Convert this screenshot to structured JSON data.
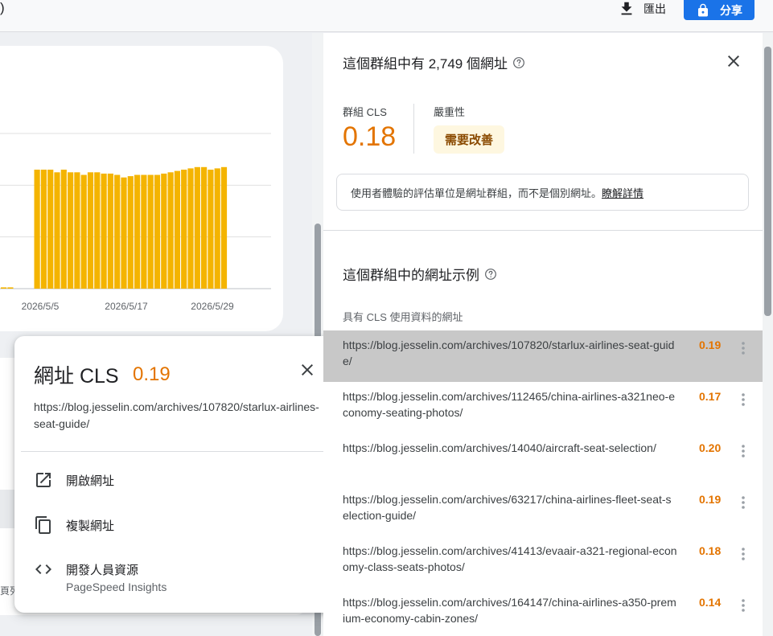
{
  "topbar": {
    "paren_fragment": ")",
    "export_label": "匯出",
    "share_label": "分享"
  },
  "chart_data": {
    "type": "bar",
    "x_tick_labels": [
      "2026/5/5",
      "2026/5/17",
      "2026/5/29"
    ],
    "values": [
      0.005,
      0.005,
      0,
      0,
      0,
      0.46,
      0.46,
      0.46,
      0.45,
      0.46,
      0.45,
      0.45,
      0.44,
      0.45,
      0.45,
      0.445,
      0.445,
      0.44,
      0.43,
      0.435,
      0.44,
      0.44,
      0.44,
      0.44,
      0.445,
      0.45,
      0.455,
      0.46,
      0.465,
      0.47,
      0.47,
      0.46,
      0.465,
      0.47
    ],
    "ylim": [
      0,
      0.6
    ],
    "color": "#f4b400",
    "grid": true,
    "legend": "none"
  },
  "left": {
    "truncated_text": "頁列"
  },
  "popup": {
    "title": "網址 CLS",
    "value": "0.19",
    "url": "https://blog.jesselin.com/archives/107820/starlux-airlines-seat-guide/",
    "items": [
      {
        "icon": "open-in-new-icon",
        "label": "開啟網址",
        "sub": ""
      },
      {
        "icon": "copy-icon",
        "label": "複製網址",
        "sub": ""
      },
      {
        "icon": "code-icon",
        "label": "開發人員資源",
        "sub": "PageSpeed Insights"
      }
    ]
  },
  "panel": {
    "title": "這個群組中有 2,749 個網址",
    "cls_label": "群組 CLS",
    "cls_value": "0.18",
    "severity_label": "嚴重性",
    "severity_value": "需要改善",
    "severity_color": "#e37400",
    "info_text": "使用者體驗的評估單位是網址群組，而不是個別網址。",
    "info_link": "瞭解詳情",
    "examples_title": "這個群組中的網址示例",
    "column_header": "具有 CLS 使用資料的網址",
    "rows": [
      {
        "url": "https://blog.jesselin.com/archives/107820/starlux-airlines-seat-guide/",
        "cls": "0.19",
        "selected": true
      },
      {
        "url": "https://blog.jesselin.com/archives/112465/china-airlines-a321neo-economy-seating-photos/",
        "cls": "0.17",
        "selected": false
      },
      {
        "url": "https://blog.jesselin.com/archives/14040/aircraft-seat-selection/",
        "cls": "0.20",
        "selected": false
      },
      {
        "url": "https://blog.jesselin.com/archives/63217/china-airlines-fleet-seat-selection-guide/",
        "cls": "0.19",
        "selected": false
      },
      {
        "url": "https://blog.jesselin.com/archives/41413/evaair-a321-regional-economy-class-seats-photos/",
        "cls": "0.18",
        "selected": false
      },
      {
        "url": "https://blog.jesselin.com/archives/164147/china-airlines-a350-premium-economy-cabin-zones/",
        "cls": "0.14",
        "selected": false
      }
    ]
  }
}
